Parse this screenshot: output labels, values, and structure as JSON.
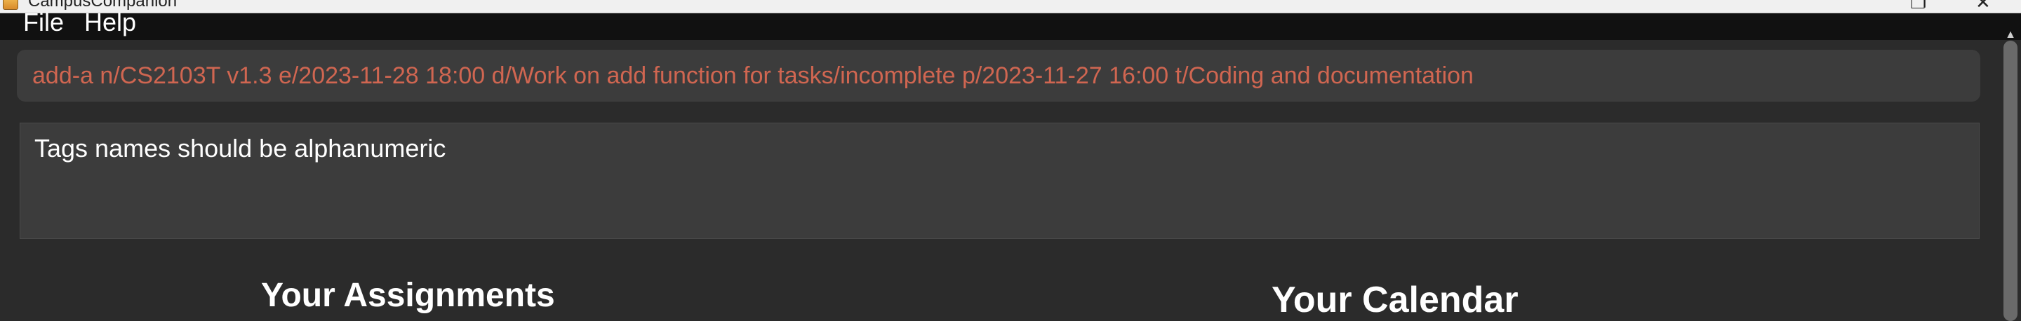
{
  "window": {
    "title": "CampusCompanion",
    "restore_glyph": "❐",
    "close_glyph": "✕"
  },
  "menu": {
    "file": "File",
    "help": "Help"
  },
  "command_box": {
    "value": "add-a n/CS2103T v1.3 e/2023-11-28 18:00 d/Work on add function for tasks/incomplete p/2023-11-27 16:00 t/Coding and documentation",
    "text_color": "#d06651"
  },
  "result_display": {
    "message": "Tags names should be alphanumeric"
  },
  "sections": {
    "assignments_title": "Your Assignments",
    "calendar_title": "Your Calendar"
  },
  "colors": {
    "background": "#2b2b2b",
    "menubar": "#111111",
    "panel": "#3c3c3c",
    "error_text": "#d06651"
  }
}
